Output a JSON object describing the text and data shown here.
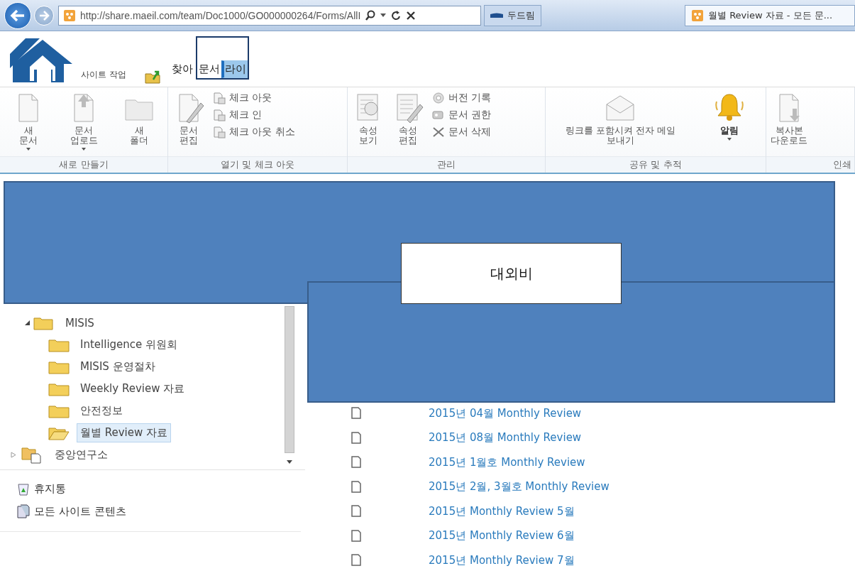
{
  "browser": {
    "address": "http://share.maeil.com/team/Doc1000/GO000000264/Forms/AllI",
    "tabs": [
      {
        "title": "두드림",
        "selected": false
      },
      {
        "title": "월별 Review 자료 - 모든 문...",
        "selected": true
      }
    ]
  },
  "site": {
    "actions_label": "사이트 작업",
    "ribbon_tabs": [
      {
        "label": "찾아",
        "kind": "plain",
        "selected": false
      },
      {
        "label": "문서",
        "kind": "contextual",
        "selected": true
      },
      {
        "label": "라이",
        "kind": "contextual",
        "selected": false
      }
    ]
  },
  "ribbon": {
    "groups": [
      {
        "label": "새로 만들기",
        "items": [
          {
            "kind": "large",
            "label": "새\n문서",
            "dropdown": true,
            "emphasis": false
          },
          {
            "kind": "large",
            "label": "문서\n업로드",
            "dropdown": true,
            "emphasis": false
          },
          {
            "kind": "large",
            "label": "새\n폴더",
            "dropdown": false,
            "emphasis": false
          }
        ]
      },
      {
        "label": "열기 및 체크 아웃",
        "items": [
          {
            "kind": "large",
            "label": "문서\n편집",
            "dropdown": false,
            "emphasis": false
          },
          {
            "kind": "small",
            "label": "체크 아웃"
          },
          {
            "kind": "small",
            "label": "체크 인"
          },
          {
            "kind": "small",
            "label": "체크 아웃 취소"
          }
        ]
      },
      {
        "label": "관리",
        "items": [
          {
            "kind": "large",
            "label": "속성\n보기",
            "dropdown": false,
            "emphasis": false
          },
          {
            "kind": "large",
            "label": "속성\n편집",
            "dropdown": false,
            "emphasis": false
          },
          {
            "kind": "small",
            "label": "버전 기록"
          },
          {
            "kind": "small",
            "label": "문서 권한"
          },
          {
            "kind": "small",
            "label": "문서 삭제"
          }
        ]
      },
      {
        "label": "공유 및 추적",
        "items": [
          {
            "kind": "large",
            "label": "링크를 포함시켜 전자 메일\n보내기",
            "dropdown": false,
            "emphasis": false
          },
          {
            "kind": "large",
            "label": "알림",
            "dropdown": true,
            "emphasis": true
          }
        ]
      },
      {
        "label": "인쇄",
        "items": [
          {
            "kind": "large",
            "label": "복사본\n다운로드",
            "dropdown": false,
            "emphasis": false
          }
        ]
      }
    ]
  },
  "navigation": {
    "tree": [
      {
        "label": "MISIS",
        "kind": "folder",
        "expanded": true,
        "selected": false,
        "children": [
          {
            "label": "Intelligence 위원회",
            "selected": false
          },
          {
            "label": "MISIS 운영절차",
            "selected": false
          },
          {
            "label": "Weekly Review 자료",
            "selected": false
          },
          {
            "label": "안전정보",
            "selected": false
          },
          {
            "label": "월별 Review 자료",
            "selected": true
          }
        ]
      },
      {
        "label": "중앙연구소",
        "kind": "site",
        "expanded": false,
        "selected": false
      }
    ],
    "quick_links": [
      {
        "label": "휴지통",
        "kind": "recycle"
      },
      {
        "label": "모든 사이트 콘텐츠",
        "kind": "contents"
      }
    ]
  },
  "documents": [
    {
      "name": "2015년 04월 Monthly Review"
    },
    {
      "name": "2015년 08월 Monthly Review"
    },
    {
      "name": "2015년 1월호 Monthly Review"
    },
    {
      "name": "2015년 2월, 3월호 Monthly Review"
    },
    {
      "name": "2015년 Monthly Review 5월"
    },
    {
      "name": "2015년 Monthly Review 6월"
    },
    {
      "name": "2015년 Monthly Review 7월"
    }
  ],
  "redaction": {
    "label": "대외비"
  }
}
